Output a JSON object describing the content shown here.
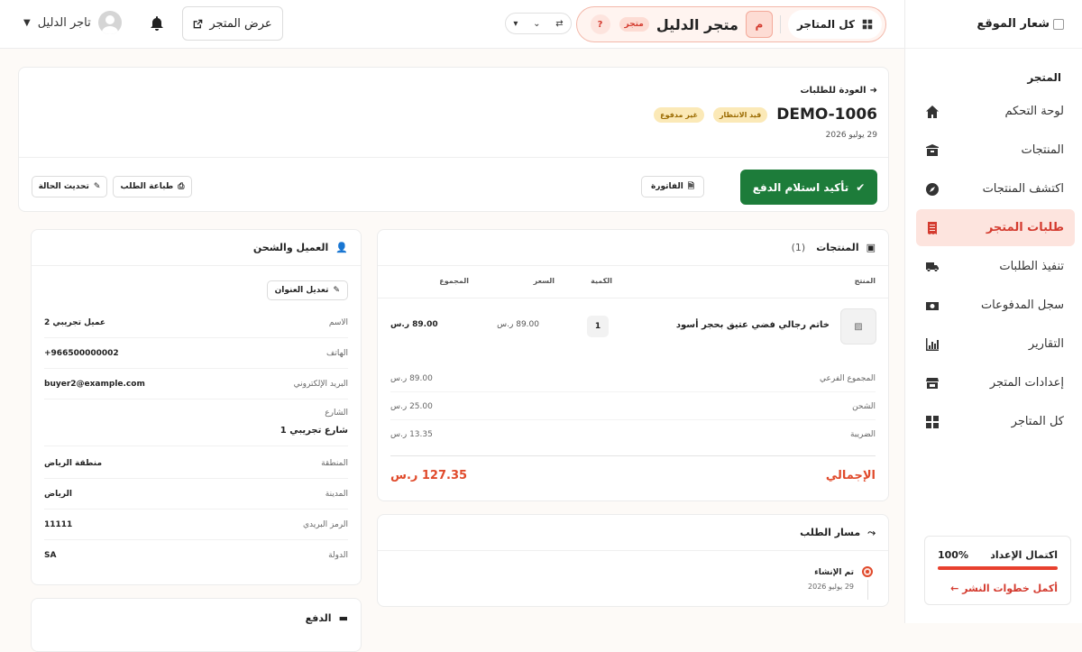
{
  "sidebar": {
    "logo_alt": "شعار الموقع",
    "section": "المتجر",
    "items": [
      {
        "label": "لوحة التحكم",
        "icon": "home-icon"
      },
      {
        "label": "المنتجات",
        "icon": "box-icon"
      },
      {
        "label": "اكتشف المنتجات",
        "icon": "compass-icon"
      },
      {
        "label": "طلبات المتجر",
        "icon": "receipt-icon",
        "active": true
      },
      {
        "label": "تنفيذ الطلبات",
        "icon": "truck-icon"
      },
      {
        "label": "سجل المدفوعات",
        "icon": "money-icon"
      },
      {
        "label": "التقارير",
        "icon": "chart-icon"
      },
      {
        "label": "إعدادات المتجر",
        "icon": "store-icon"
      },
      {
        "label": "كل المتاجر",
        "icon": "grid-icon"
      }
    ],
    "setup": {
      "title": "اكتمال الإعداد",
      "percent": "100%",
      "progress": 1.0,
      "link": "أكمل خطوات النشر ←"
    }
  },
  "topbar": {
    "all_stores": "كل المتاجر",
    "store_initial": "م",
    "store_name": "متجر الدليل",
    "store_tag": "متجر",
    "help": "?",
    "view_store": "عرض المتجر",
    "user_name": "تاجر الدليل"
  },
  "order": {
    "back": "العودة للطلبات",
    "id": "DEMO-1006",
    "status_pending": "قيد الانتظار",
    "status_unpaid": "غير مدفوع",
    "date": "29 يوليو 2026",
    "confirm_btn": "تأكيد استلام الدفع",
    "invoice_btn": "الفاتورة",
    "print_btn": "طباعة الطلب",
    "update_btn": "تحديث الحالة"
  },
  "products": {
    "title": "المنتجات",
    "count": "(1)",
    "headers": {
      "product": "المنتج",
      "qty": "الكمية",
      "price": "السعر",
      "total": "المجموع"
    },
    "item": {
      "name": "خاتم رجالي فضي عتيق بحجر أسود",
      "qty": "1",
      "price": "89.00 ر.س",
      "total": "89.00 ر.س"
    },
    "subtotal_label": "المجموع الفرعي",
    "subtotal": "89.00 ر.س",
    "shipping_label": "الشحن",
    "shipping": "25.00 ر.س",
    "tax_label": "الضريبة",
    "tax": "13.35 ر.س",
    "grand_label": "الإجمالي",
    "grand": "127.35 ر.س"
  },
  "tracking": {
    "title": "مسار الطلب",
    "event": "تم الإنشاء",
    "event_date": "29 يوليو 2026"
  },
  "customer": {
    "title": "العميل والشحن",
    "edit_btn": "تعديل العنوان",
    "name_label": "الاسم",
    "name": "عميل تجريبي 2",
    "phone_label": "الهاتف",
    "phone": "+966500000002",
    "email_label": "البريد الإلكتروني",
    "email": "buyer2@example.com",
    "street_label": "الشارع",
    "street": "شارع تجريبي 1",
    "region_label": "المنطقة",
    "region": "منطقة الرياض",
    "city_label": "المدينة",
    "city": "الرياض",
    "zip_label": "الرمز البريدي",
    "zip": "11111",
    "country_label": "الدولة",
    "country": "SA"
  },
  "payment": {
    "title": "الدفع"
  }
}
